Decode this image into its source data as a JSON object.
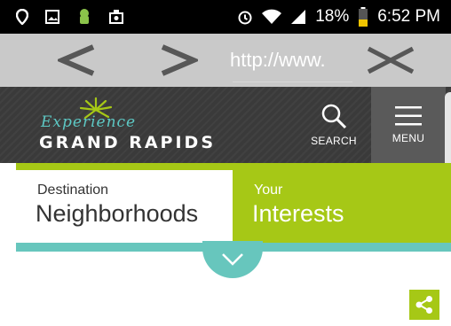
{
  "status_bar": {
    "battery_percent": "18%",
    "time": "6:52 PM",
    "icons": [
      "location-icon",
      "gallery-icon",
      "android-icon",
      "media-icon",
      "alarm-icon",
      "wifi-icon",
      "signal-icon",
      "battery-icon"
    ]
  },
  "browser": {
    "url": "http://www.",
    "icons": [
      "back-arrow-icon",
      "forward-arrow-icon",
      "close-icon"
    ]
  },
  "header": {
    "logo_script": "Experience",
    "logo_wordmark": "GRAND RAPIDS",
    "search_label": "SEARCH",
    "menu_label": "MENU"
  },
  "tabs": [
    {
      "small": "Destination",
      "big": "Neighborhoods"
    },
    {
      "small": "Your",
      "big": "Interests"
    }
  ],
  "colors": {
    "header_bg": "#3a3a3a",
    "menu_bg": "#5a5a5a",
    "lime": "#a6c816",
    "teal": "#67c6bd",
    "browser_bar": "#c9c9c9"
  }
}
